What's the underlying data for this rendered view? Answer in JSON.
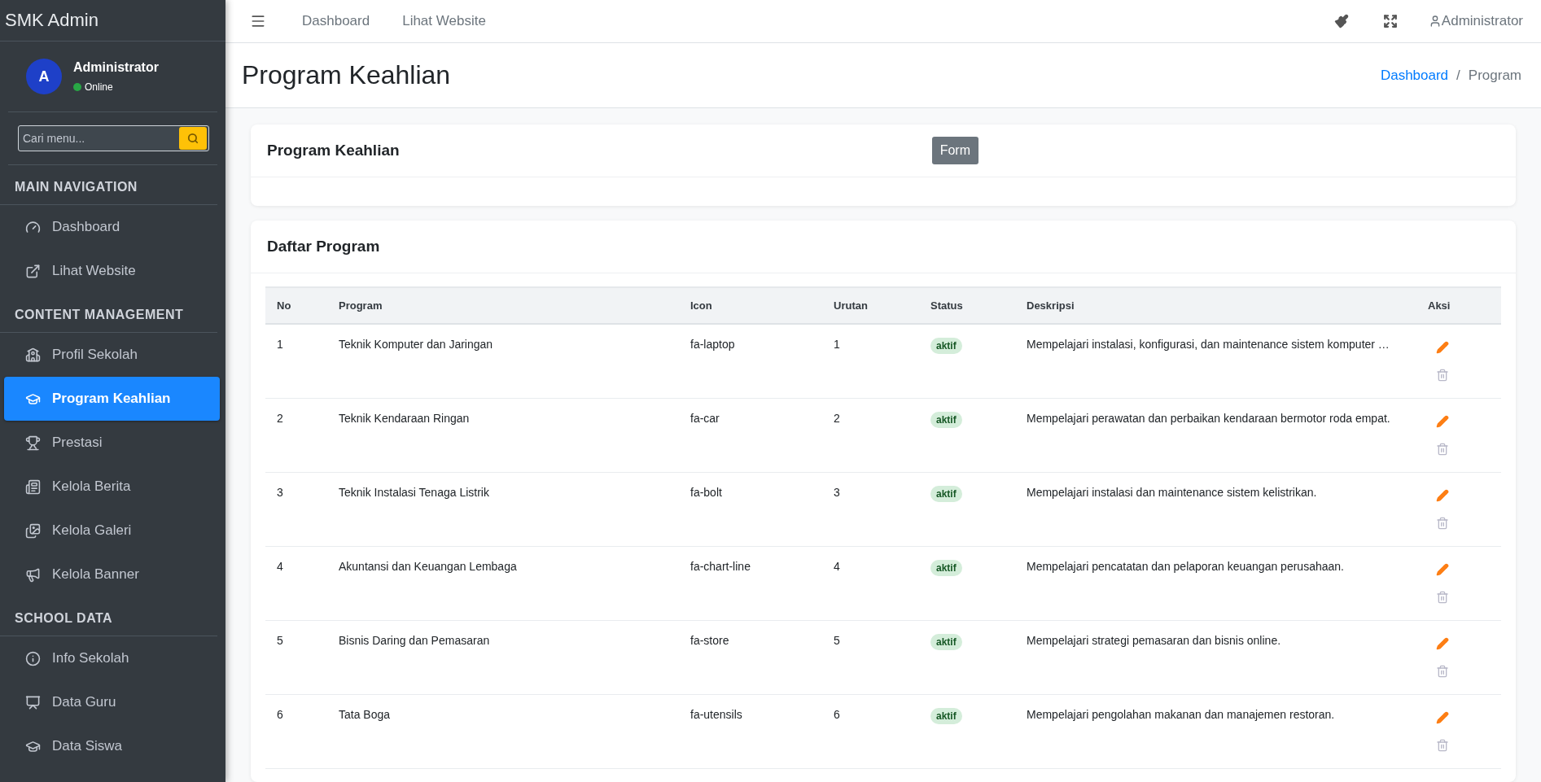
{
  "sidebar": {
    "brand": "SMK Admin",
    "user": {
      "avatar": "A",
      "name": "Administrator",
      "status": "Online"
    },
    "search": {
      "placeholder": "Cari menu..."
    },
    "sections": [
      {
        "title": "MAIN NAVIGATION",
        "items": [
          {
            "label": "Dashboard",
            "selected": false
          },
          {
            "label": "Lihat Website",
            "selected": false
          }
        ]
      },
      {
        "title": "CONTENT MANAGEMENT",
        "items": [
          {
            "label": "Profil Sekolah",
            "selected": false
          },
          {
            "label": "Program Keahlian",
            "selected": true
          },
          {
            "label": "Prestasi",
            "selected": false
          },
          {
            "label": "Kelola Berita",
            "selected": false
          },
          {
            "label": "Kelola Galeri",
            "selected": false
          },
          {
            "label": "Kelola Banner",
            "selected": false
          }
        ]
      },
      {
        "title": "SCHOOL DATA",
        "items": [
          {
            "label": "Info Sekolah",
            "selected": false
          },
          {
            "label": "Data Guru",
            "selected": false
          },
          {
            "label": "Data Siswa",
            "selected": false
          }
        ]
      }
    ]
  },
  "topbar": {
    "links": [
      "Dashboard",
      "Lihat Website"
    ],
    "user": "Administrator"
  },
  "header": {
    "title": "Program Keahlian",
    "breadcrumb_separator": "/",
    "breadcrumb": [
      {
        "label": "Dashboard",
        "kind": "link"
      },
      {
        "label": "Program",
        "kind": "current"
      }
    ]
  },
  "form_card": {
    "title": "Program Keahlian",
    "button": "Form"
  },
  "list_card": {
    "title": "Daftar Program",
    "columns": [
      "No",
      "Program",
      "Icon",
      "Urutan",
      "Status",
      "Deskripsi",
      "Aksi"
    ],
    "rows": [
      {
        "no": "1",
        "program": "Teknik Komputer dan Jaringan",
        "icon": "fa-laptop",
        "urutan": "1",
        "status": "aktif",
        "deskripsi": "Mempelajari instalasi, konfigurasi, dan maintenance sistem komputer …"
      },
      {
        "no": "2",
        "program": "Teknik Kendaraan Ringan",
        "icon": "fa-car",
        "urutan": "2",
        "status": "aktif",
        "deskripsi": "Mempelajari perawatan dan perbaikan kendaraan bermotor roda empat."
      },
      {
        "no": "3",
        "program": "Teknik Instalasi Tenaga Listrik",
        "icon": "fa-bolt",
        "urutan": "3",
        "status": "aktif",
        "deskripsi": "Mempelajari instalasi dan maintenance sistem kelistrikan."
      },
      {
        "no": "4",
        "program": "Akuntansi dan Keuangan Lembaga",
        "icon": "fa-chart-line",
        "urutan": "4",
        "status": "aktif",
        "deskripsi": "Mempelajari pencatatan dan pelaporan keuangan perusahaan."
      },
      {
        "no": "5",
        "program": "Bisnis Daring dan Pemasaran",
        "icon": "fa-store",
        "urutan": "5",
        "status": "aktif",
        "deskripsi": "Mempelajari strategi pemasaran dan bisnis online."
      },
      {
        "no": "6",
        "program": "Tata Boga",
        "icon": "fa-utensils",
        "urutan": "6",
        "status": "aktif",
        "deskripsi": "Mempelajari pengolahan makanan dan manajemen restoran."
      }
    ]
  }
}
